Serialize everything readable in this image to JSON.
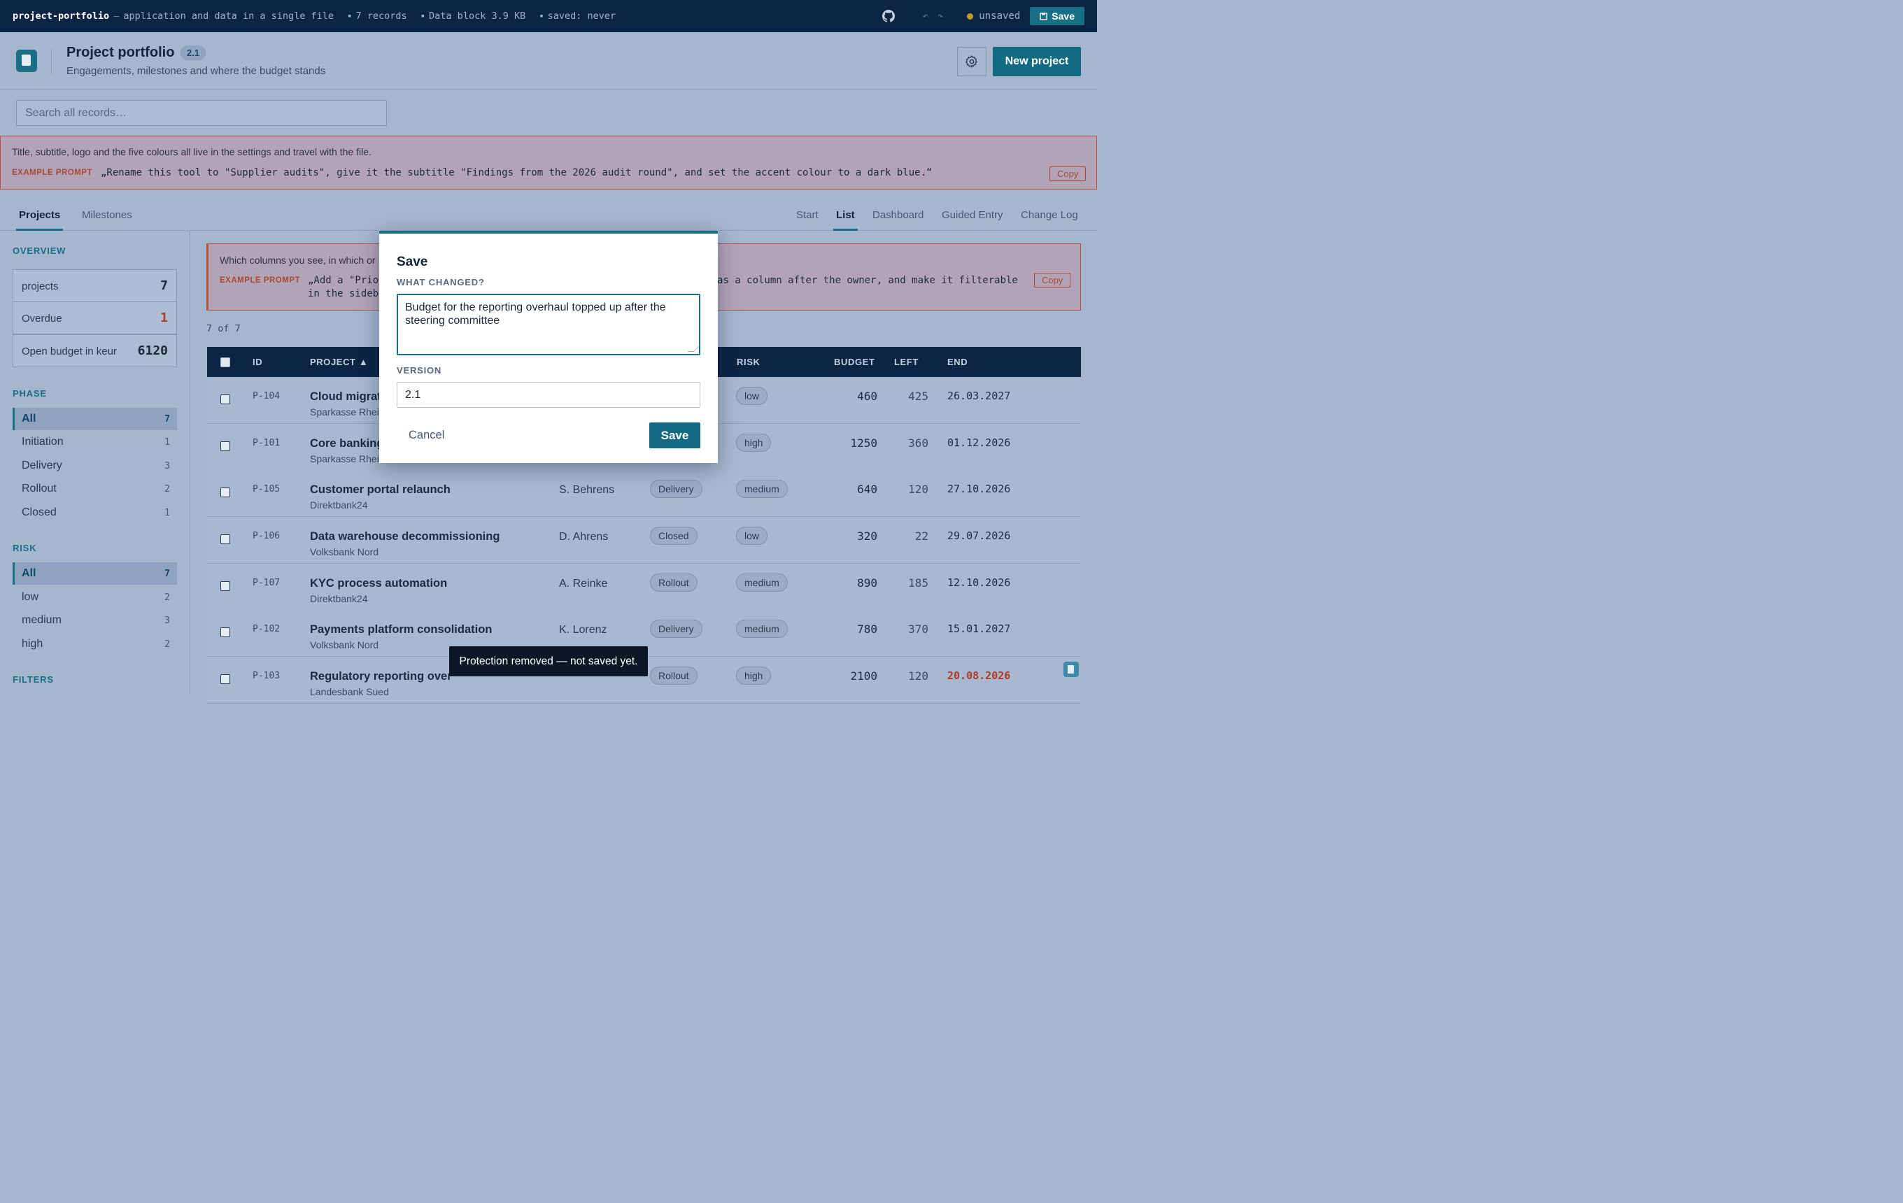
{
  "topbar": {
    "app_name": "project-portfolio",
    "tagline": "application and data in a single file",
    "records": "7 records",
    "data_block": "Data block 3.9 KB",
    "saved": "saved: never",
    "status": "unsaved",
    "save_label": "Save"
  },
  "header": {
    "title": "Project portfolio",
    "version": "2.1",
    "subtitle": "Engagements, milestones and where the budget stands",
    "new_button": "New project"
  },
  "search": {
    "placeholder": "Search all records…"
  },
  "banner": {
    "text": "Title, subtitle, logo and the five colours all live in the settings and travel with the file.",
    "label": "EXAMPLE PROMPT",
    "prompt": "„Rename this tool to \"Supplier audits\", give it the subtitle \"Findings from the 2026 audit round\", and set the accent colour to a dark blue.“",
    "copy": "Copy"
  },
  "tabs": {
    "left": [
      "Projects",
      "Milestones"
    ],
    "right": [
      "Start",
      "List",
      "Dashboard",
      "Guided Entry",
      "Change Log"
    ]
  },
  "sidebar": {
    "overview_title": "OVERVIEW",
    "stats": [
      {
        "label": "projects",
        "value": "7"
      },
      {
        "label": "Overdue",
        "value": "1"
      },
      {
        "label": "Open budget in keur",
        "value": "6120"
      }
    ],
    "phase_title": "PHASE",
    "phases": [
      {
        "label": "All",
        "count": "7"
      },
      {
        "label": "Initiation",
        "count": "1"
      },
      {
        "label": "Delivery",
        "count": "3"
      },
      {
        "label": "Rollout",
        "count": "2"
      },
      {
        "label": "Closed",
        "count": "1"
      }
    ],
    "risk_title": "RISK",
    "risks": [
      {
        "label": "All",
        "count": "7"
      },
      {
        "label": "low",
        "count": "2"
      },
      {
        "label": "medium",
        "count": "3"
      },
      {
        "label": "high",
        "count": "2"
      }
    ],
    "filters_title": "FILTERS"
  },
  "main": {
    "banner": {
      "text": "Which columns you see, in which or",
      "label": "EXAMPLE PROMPT",
      "prompt_line1": "„Add a \"Prior",
      "prompt_line2": "in the sideba",
      "prompt_right": "as a column after the owner, and make it filterable",
      "copy": "Copy"
    },
    "count": "7 of 7",
    "columns": {
      "id": "ID",
      "project": "PROJECT ▲",
      "risk": "RISK",
      "budget": "BUDGET",
      "left": "LEFT",
      "end": "END"
    },
    "rows": [
      {
        "id": "P-104",
        "name": "Cloud migrat",
        "client": "Sparkasse Rhei",
        "owner": "",
        "phase": "",
        "risk": "low",
        "budget": "460",
        "left": "425",
        "end": "26.03.2027"
      },
      {
        "id": "P-101",
        "name": "Core banking",
        "client": "Sparkasse Rhei",
        "owner": "",
        "phase": "",
        "risk": "high",
        "budget": "1250",
        "left": "360",
        "end": "01.12.2026"
      },
      {
        "id": "P-105",
        "name": "Customer portal relaunch",
        "client": "Direktbank24",
        "owner": "S. Behrens",
        "phase": "Delivery",
        "risk": "medium",
        "budget": "640",
        "left": "120",
        "end": "27.10.2026"
      },
      {
        "id": "P-106",
        "name": "Data warehouse decommissioning",
        "client": "Volksbank Nord",
        "owner": "D. Ahrens",
        "phase": "Closed",
        "risk": "low",
        "budget": "320",
        "left": "22",
        "end": "29.07.2026"
      },
      {
        "id": "P-107",
        "name": "KYC process automation",
        "client": "Direktbank24",
        "owner": "A. Reinke",
        "phase": "Rollout",
        "risk": "medium",
        "budget": "890",
        "left": "185",
        "end": "12.10.2026"
      },
      {
        "id": "P-102",
        "name": "Payments platform consolidation",
        "client": "Volksbank Nord",
        "owner": "K. Lorenz",
        "phase": "Delivery",
        "risk": "medium",
        "budget": "780",
        "left": "370",
        "end": "15.01.2027"
      },
      {
        "id": "P-103",
        "name": "Regulatory reporting over",
        "client": "Landesbank Sued",
        "owner": "",
        "phase": "Rollout",
        "risk": "high",
        "budget": "2100",
        "left": "120",
        "end": "20.08.2026"
      }
    ]
  },
  "modal": {
    "title": "Save",
    "what_label": "WHAT CHANGED?",
    "what_value": "Budget for the reporting overhaul topped up after the steering committee",
    "version_label": "VERSION",
    "version_value": "2.1",
    "cancel": "Cancel",
    "save": "Save"
  },
  "toast": "Protection removed — not saved yet.",
  "colors": {
    "accent": "#1a6f86",
    "navy": "#0d2545",
    "warning": "#b3553d",
    "overdue": "#b03a24"
  }
}
